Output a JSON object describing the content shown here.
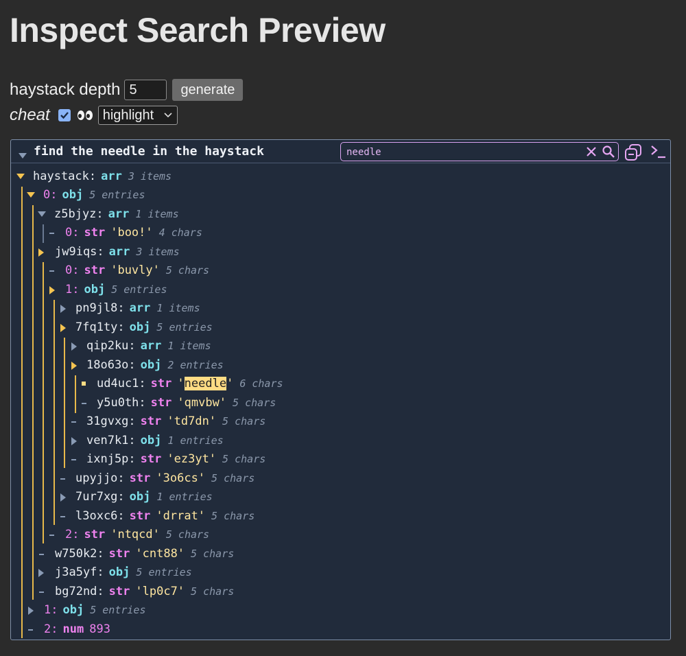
{
  "page": {
    "title": "Inspect Search Preview"
  },
  "controls": {
    "depth_label": "haystack depth",
    "depth_value": "5",
    "generate_label": "generate",
    "cheat_label": "cheat",
    "cheat_checked": true,
    "mode_selected": "highlight"
  },
  "panel": {
    "title": "find the needle in the haystack",
    "search_value": "needle"
  },
  "tree": [
    {
      "key": "haystack",
      "type": "arr",
      "meta": "3 items"
    },
    {
      "key": "0",
      "type": "obj",
      "meta": "5 entries"
    },
    {
      "key": "z5bjyz",
      "type": "arr",
      "meta": "1 items"
    },
    {
      "key": "0",
      "type": "str",
      "value": "'boo!'",
      "meta": "4 chars"
    },
    {
      "key": "jw9iqs",
      "type": "arr",
      "meta": "3 items"
    },
    {
      "key": "0",
      "type": "str",
      "value": "'buvly'",
      "meta": "5 chars"
    },
    {
      "key": "1",
      "type": "obj",
      "meta": "5 entries"
    },
    {
      "key": "pn9jl8",
      "type": "arr",
      "meta": "1 items"
    },
    {
      "key": "7fq1ty",
      "type": "obj",
      "meta": "5 entries"
    },
    {
      "key": "qip2ku",
      "type": "arr",
      "meta": "1 items"
    },
    {
      "key": "18o63o",
      "type": "obj",
      "meta": "2 entries"
    },
    {
      "key": "ud4uc1",
      "type": "str",
      "value_pre": "'",
      "value_hl": "needle",
      "value_post": "'",
      "meta": "6 chars"
    },
    {
      "key": "y5u0th",
      "type": "str",
      "value": "'qmvbw'",
      "meta": "5 chars"
    },
    {
      "key": "31gvxg",
      "type": "str",
      "value": "'td7dn'",
      "meta": "5 chars"
    },
    {
      "key": "ven7k1",
      "type": "obj",
      "meta": "1 entries"
    },
    {
      "key": "ixnj5p",
      "type": "str",
      "value": "'ez3yt'",
      "meta": "5 chars"
    },
    {
      "key": "upyjjo",
      "type": "str",
      "value": "'3o6cs'",
      "meta": "5 chars"
    },
    {
      "key": "7ur7xg",
      "type": "obj",
      "meta": "1 entries"
    },
    {
      "key": "l3oxc6",
      "type": "str",
      "value": "'drrat'",
      "meta": "5 chars"
    },
    {
      "key": "2",
      "type": "str",
      "value": "'ntqcd'",
      "meta": "5 chars"
    },
    {
      "key": "w750k2",
      "type": "str",
      "value": "'cnt88'",
      "meta": "5 chars"
    },
    {
      "key": "j3a5yf",
      "type": "obj",
      "meta": "5 entries"
    },
    {
      "key": "bg72nd",
      "type": "str",
      "value": "'lp0c7'",
      "meta": "5 chars"
    },
    {
      "key": "1",
      "type": "obj",
      "meta": "5 entries"
    },
    {
      "key": "2",
      "type": "num",
      "value": "893"
    }
  ],
  "colors": {
    "page_bg": "#2b2b2b",
    "panel_bg": "#212b3b",
    "key_pink": "#ee82ee",
    "type_cyan": "#7ee0ea",
    "string_yellow": "#ffe6a0",
    "highlight": "#ffdc84",
    "guide_gold": "#e8b94a"
  },
  "icons": [
    "triangle-down-icon",
    "triangle-right-icon",
    "clear-icon",
    "search-icon",
    "collapse-all-icon",
    "console-icon",
    "checkbox-checked-icon",
    "eyes-icon",
    "chevron-down-icon"
  ]
}
